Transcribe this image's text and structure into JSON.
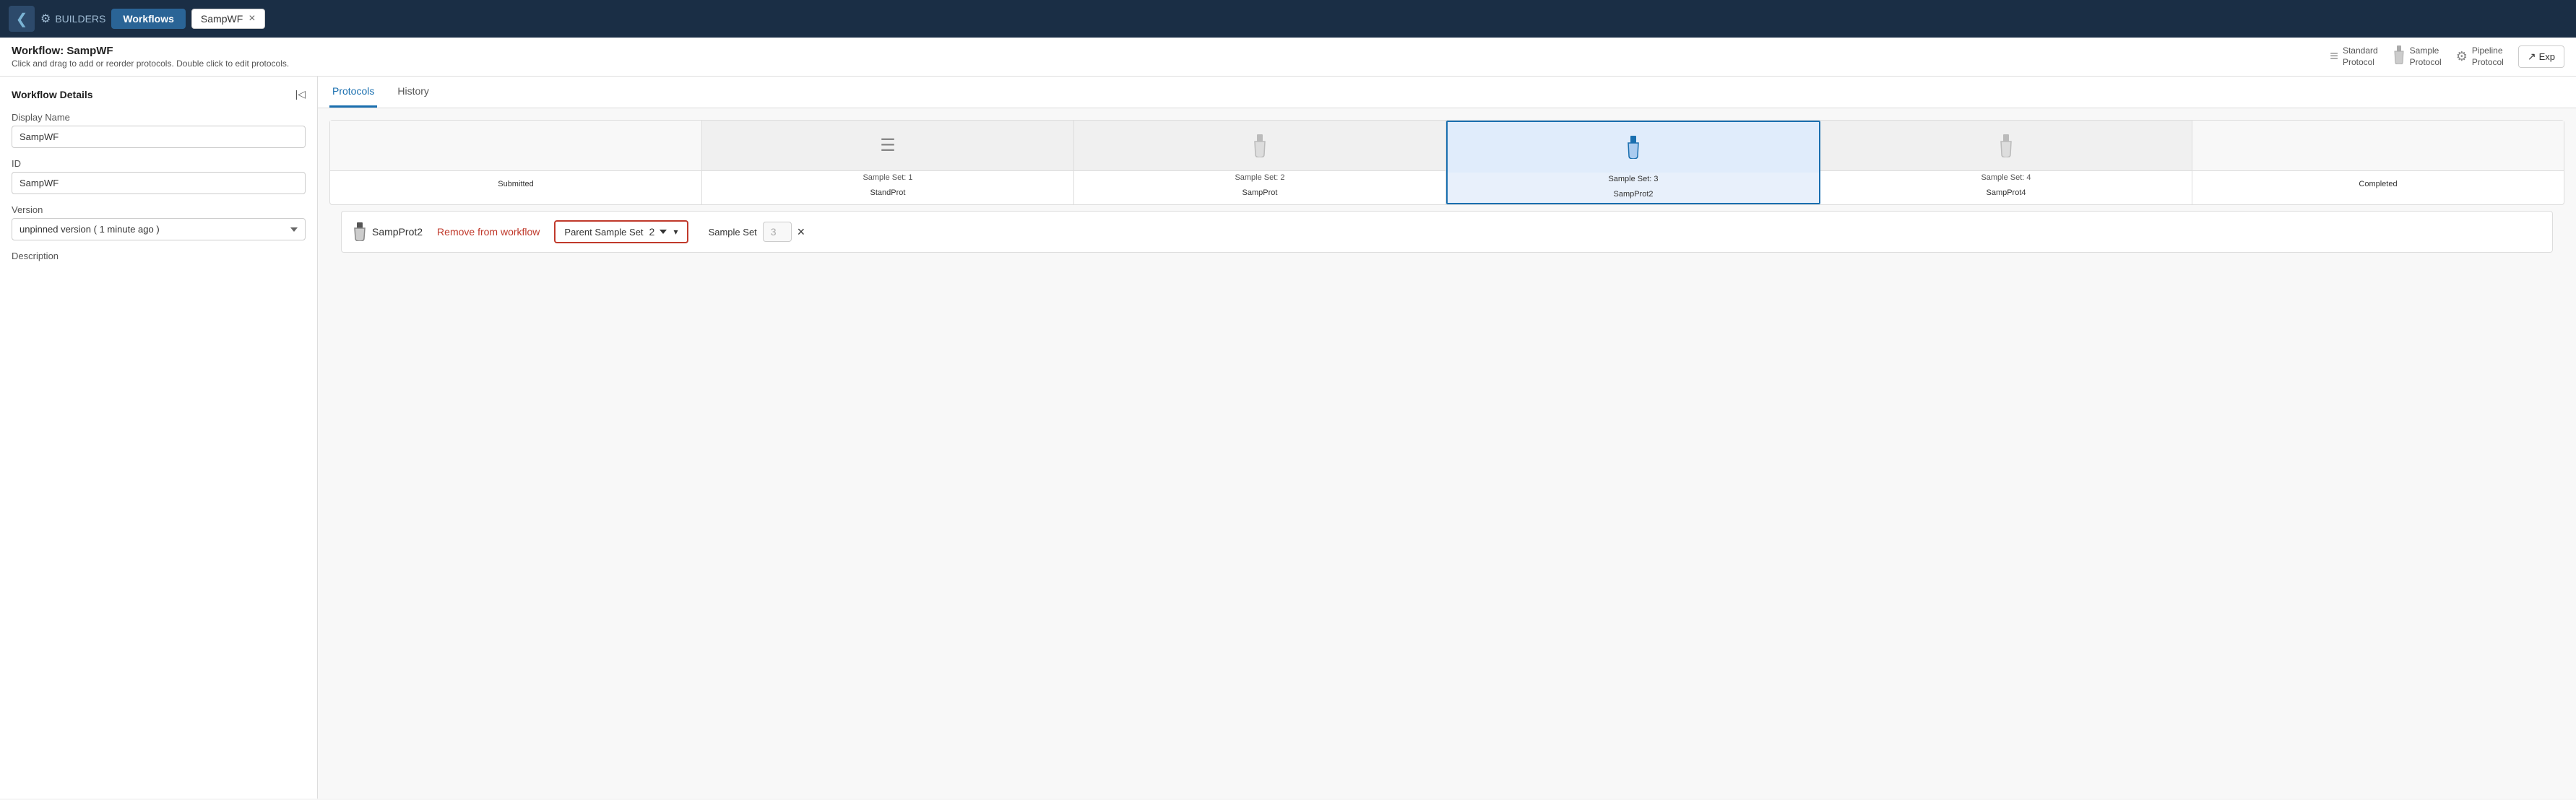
{
  "nav": {
    "back_icon": "❮",
    "builders_label": "BUILDERS",
    "builders_icon": "≡",
    "workflows_label": "Workflows",
    "tab_name": "SampWF",
    "tab_close": "×"
  },
  "header": {
    "title": "Workflow: SampWF",
    "subtitle": "Click and drag to add or reorder protocols. Double click to edit protocols.",
    "protocol_types": [
      {
        "icon": "≡",
        "label": "Standard\nProtocol"
      },
      {
        "icon": "🧪",
        "label": "Sample\nProtocol"
      },
      {
        "icon": "⚙",
        "label": "Pipeline\nProtocol"
      }
    ],
    "export_label": "Exp"
  },
  "sidebar": {
    "title": "Workflow Details",
    "collapse_icon": "|<",
    "display_name_label": "Display Name",
    "display_name_value": "SampWF",
    "id_label": "ID",
    "id_value": "SampWF",
    "version_label": "Version",
    "version_value": "unpinned version ( 1 minute ago )",
    "description_label": "Description"
  },
  "tabs": [
    {
      "label": "Protocols",
      "active": true
    },
    {
      "label": "History",
      "active": false
    }
  ],
  "steps": [
    {
      "icon": "",
      "label": "Submitted",
      "set_label": "",
      "set_num": "",
      "type": "blank"
    },
    {
      "icon": "list",
      "label": "StandProt",
      "set_label": "Sample Set:",
      "set_num": "1",
      "type": "list"
    },
    {
      "icon": "tube",
      "label": "SampProt",
      "set_label": "Sample Set:",
      "set_num": "2",
      "type": "tube"
    },
    {
      "icon": "tube",
      "label": "SampProt2",
      "set_label": "Sample Set:",
      "set_num": "3",
      "type": "tube",
      "selected": true
    },
    {
      "icon": "tube",
      "label": "SampProt4",
      "set_label": "Sample Set:",
      "set_num": "4",
      "type": "tube"
    },
    {
      "icon": "",
      "label": "Completed",
      "set_label": "",
      "set_num": "",
      "type": "blank"
    }
  ],
  "editor": {
    "protocol_icon": "tube",
    "protocol_name": "SampProt2",
    "remove_label": "Remove from workflow",
    "parent_label": "Parent Sample Set",
    "parent_value": "2",
    "sample_set_label": "Sample Set",
    "sample_set_value": "3",
    "close_icon": "×"
  }
}
